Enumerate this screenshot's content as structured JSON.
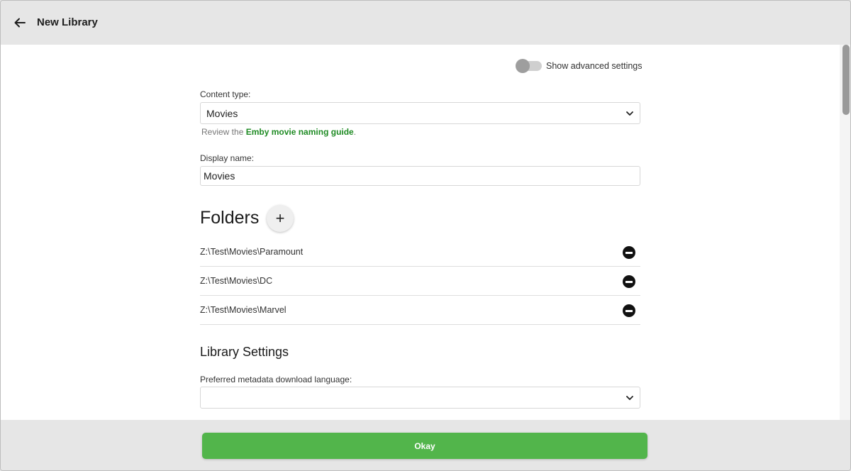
{
  "header": {
    "title": "New Library",
    "back_icon": "arrow-left-icon"
  },
  "advanced_toggle": {
    "label": "Show advanced settings",
    "state": "off"
  },
  "content_type": {
    "label": "Content type:",
    "value": "Movies",
    "icon": "chevron-down-icon"
  },
  "naming_hint": {
    "prefix": "Review the ",
    "link": "Emby movie naming guide",
    "suffix": ".",
    "link_color": "#1f8b24"
  },
  "display_name": {
    "label": "Display name:",
    "value": "Movies"
  },
  "folders": {
    "title": "Folders",
    "add_label": "+",
    "items": [
      {
        "path": "Z:\\Test\\Movies\\Paramount"
      },
      {
        "path": "Z:\\Test\\Movies\\DC"
      },
      {
        "path": "Z:\\Test\\Movies\\Marvel"
      }
    ]
  },
  "library_settings": {
    "title": "Library Settings",
    "metadata_language": {
      "label": "Preferred metadata download language:",
      "value": ""
    }
  },
  "footer": {
    "okay_label": "Okay",
    "accent": "#52b54b"
  }
}
